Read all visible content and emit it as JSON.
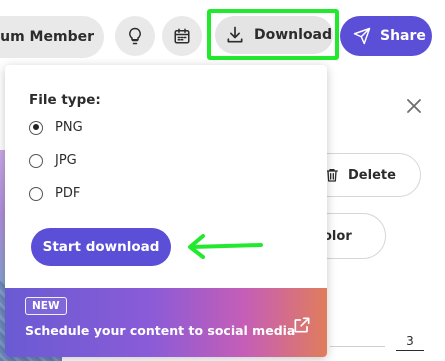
{
  "topbar": {
    "premium_label": "mium Member",
    "download_label": "Download",
    "share_label": "Share",
    "icons": [
      "lightbulb-icon",
      "calendar-icon",
      "download-icon",
      "send-icon"
    ]
  },
  "download_panel": {
    "file_type_label": "File type:",
    "options": [
      {
        "label": "PNG",
        "selected": true
      },
      {
        "label": "JPG",
        "selected": false
      },
      {
        "label": "PDF",
        "selected": false
      }
    ],
    "start_button_label": "Start download",
    "promo": {
      "badge": "NEW",
      "text": "Schedule your content to social media",
      "icon": "external-link-icon"
    }
  },
  "background_panel": {
    "delete_label": "Delete",
    "color_label": "olor",
    "value": "3"
  },
  "colors": {
    "accent": "#5a4fd6",
    "highlight": "#22e82e",
    "surface": "#e9e9e9"
  }
}
